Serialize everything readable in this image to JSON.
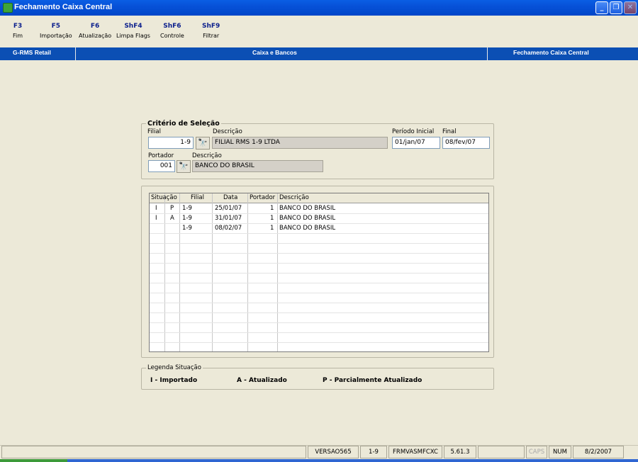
{
  "window": {
    "title": "Fechamento Caixa Central",
    "controls": [
      "_",
      "❐",
      "✕"
    ]
  },
  "toolbar": [
    {
      "key": "F3",
      "label": "Fim"
    },
    {
      "key": "F5",
      "label": "Importação"
    },
    {
      "key": "F6",
      "label": "Atualização"
    },
    {
      "key": "ShF4",
      "label": "Limpa Flags"
    },
    {
      "key": "ShF6",
      "label": "Controle"
    },
    {
      "key": "ShF9",
      "label": "Filtrar"
    }
  ],
  "header": {
    "system": "G-RMS Retail",
    "module": "Caixa e Bancos",
    "screen": "Fechamento Caixa Central"
  },
  "criteria": {
    "title": "Critério de Seleção",
    "filial_label": "Filial",
    "filial_value": "1-9",
    "descricao_label": "Descrição",
    "filial_descricao": "FILIAL RMS 1-9 LTDA",
    "periodo_inicial_label": "Período Inicial",
    "periodo_inicial_value": "01/jan/07",
    "final_label": "Final",
    "final_value": "08/fev/07",
    "portador_label": "Portador",
    "portador_value": "001",
    "portador_descricao_label": "Descrição",
    "portador_descricao": "BANCO DO BRASIL"
  },
  "grid": {
    "columns": [
      "Situação",
      "Filial",
      "Data",
      "Portador",
      "Descrição"
    ],
    "rows": [
      {
        "s1": "I",
        "s2": "P",
        "filial": "1-9",
        "data": "25/01/07",
        "portador": "1",
        "descricao": "BANCO DO BRASIL"
      },
      {
        "s1": "I",
        "s2": "A",
        "filial": "1-9",
        "data": "31/01/07",
        "portador": "1",
        "descricao": "BANCO DO BRASIL"
      },
      {
        "s1": "",
        "s2": "",
        "filial": "1-9",
        "data": "08/02/07",
        "portador": "1",
        "descricao": "BANCO DO BRASIL"
      }
    ]
  },
  "legend": {
    "title": "Legenda Situação",
    "items": [
      "I - Importado",
      "A - Atualizado",
      "P - Parcialmente Atualizado"
    ]
  },
  "status": {
    "version": "VERSAO565",
    "filial": "1-9",
    "program": "FRMVASMFCXC",
    "release": "5.61.3",
    "caps": "CAPS",
    "num": "NUM",
    "date": "8/2/2007"
  }
}
